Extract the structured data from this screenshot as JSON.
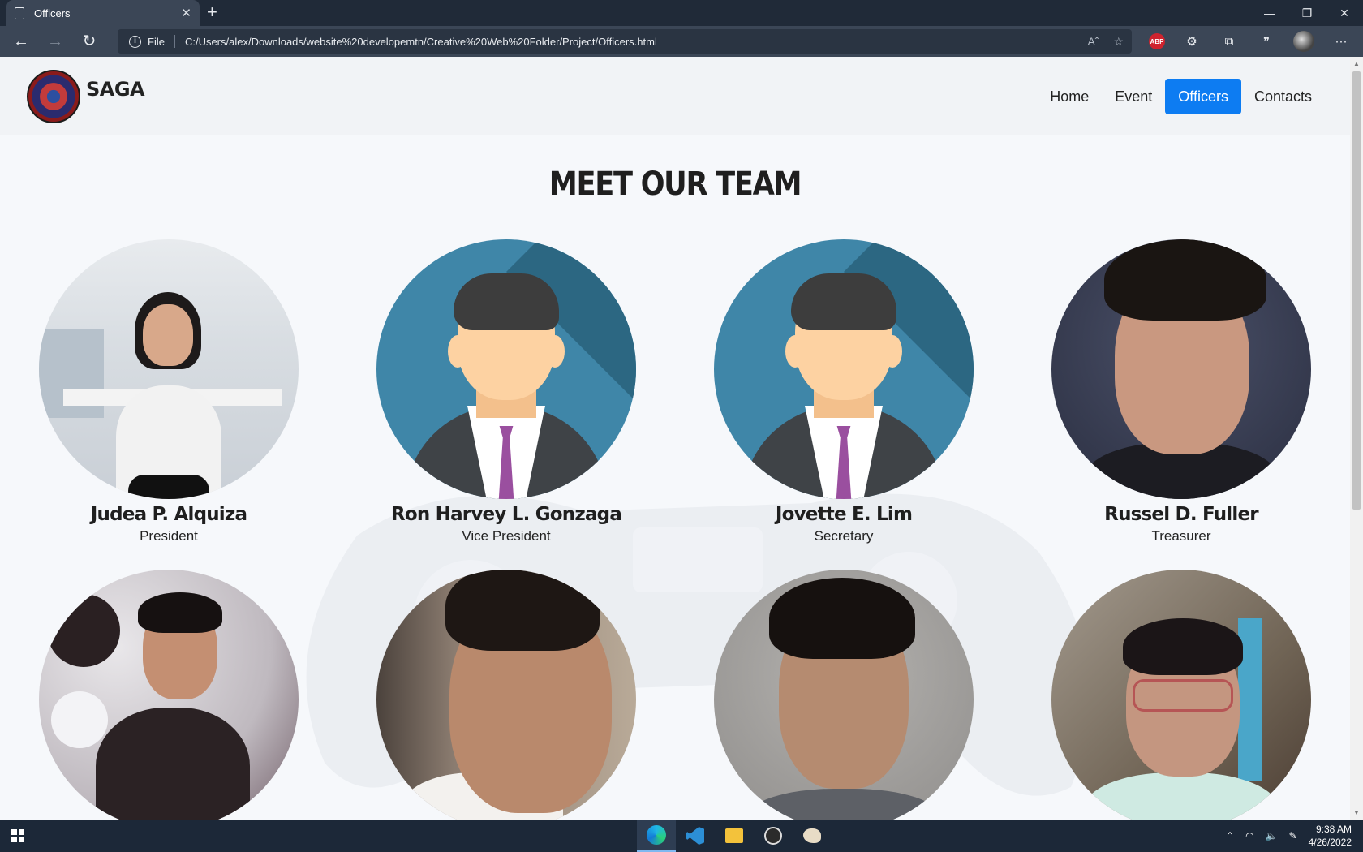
{
  "browser": {
    "tab_title": "Officers",
    "tab_close": "✕",
    "new_tab": "+",
    "address_prefix": "File",
    "url": "C:/Users/alex/Downloads/website%20developemtn/Creative%20Web%20Folder/Project/Officers.html",
    "abp_badge": "ABP",
    "window_controls": {
      "minimize": "—",
      "restore": "❐",
      "close": "✕"
    }
  },
  "site": {
    "brand": "SAGA",
    "nav": [
      {
        "label": "Home",
        "active": false
      },
      {
        "label": "Event",
        "active": false
      },
      {
        "label": "Officers",
        "active": true
      },
      {
        "label": "Contacts",
        "active": false
      }
    ],
    "heading": "MEET OUR TEAM",
    "members": [
      {
        "name": "Judea P. Alquiza",
        "role": "President",
        "photo": "photo"
      },
      {
        "name": "Ron Harvey L. Gonzaga",
        "role": "Vice President",
        "photo": "generic-avatar"
      },
      {
        "name": "Jovette E. Lim",
        "role": "Secretary",
        "photo": "generic-avatar"
      },
      {
        "name": "Russel D. Fuller",
        "role": "Treasurer",
        "photo": "photo"
      },
      {
        "name": "",
        "role": "",
        "photo": "photo"
      },
      {
        "name": "",
        "role": "",
        "photo": "photo"
      },
      {
        "name": "",
        "role": "",
        "photo": "photo"
      },
      {
        "name": "",
        "role": "",
        "photo": "photo"
      }
    ],
    "colors": {
      "active_nav": "#0d7cf2",
      "avatar_bg": "#3f86a8",
      "tie": "#9a4f9f"
    }
  },
  "taskbar": {
    "time": "9:38 AM",
    "date": "4/26/2022",
    "apps": [
      "edge-icon",
      "vscode-icon",
      "file-explorer-icon",
      "obs-icon",
      "paint-icon"
    ]
  }
}
